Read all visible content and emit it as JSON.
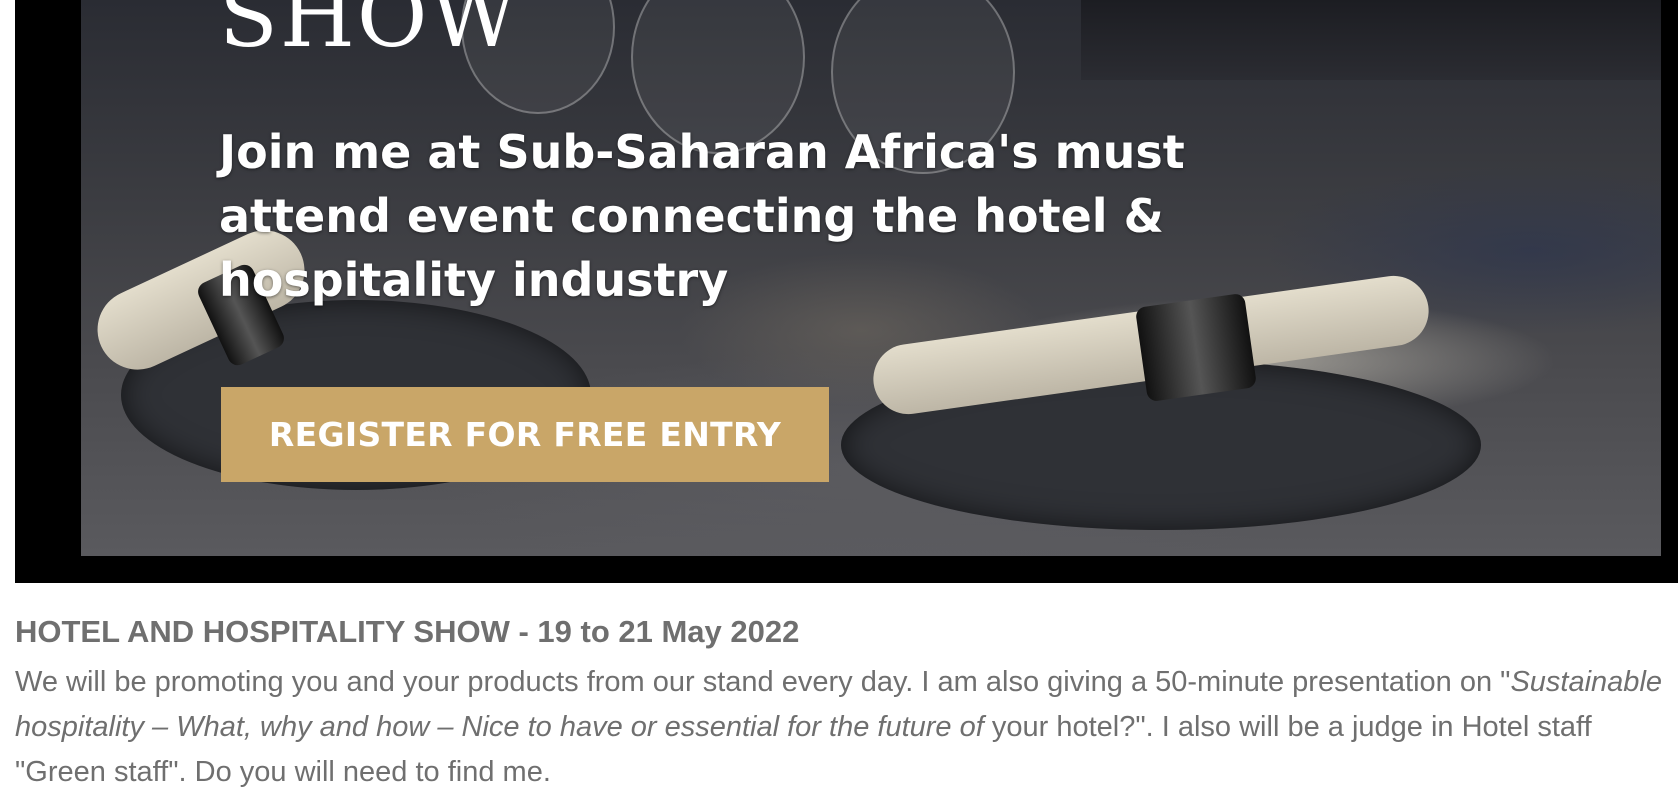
{
  "banner": {
    "logo_text": "SHOW",
    "headline": "Join me at Sub-Saharan Africa's must attend event connecting the hotel & hospitality industry",
    "cta_label": "REGISTER FOR FREE ENTRY"
  },
  "event": {
    "title": "HOTEL AND HOSPITALITY SHOW - 19 to 21 May 2022",
    "body_intro": "We will be promoting you and your products from our stand every day. I am also giving a 50-minute presentation on \"",
    "body_italic": "Sustainable hospitality – What, why and how – Nice to have or essential for the future of",
    "body_cont": " your hotel?\". I also will be a judge in Hotel staff \"Green staff\". Do you will need to find me."
  },
  "colors": {
    "cta_background": "#c9a668",
    "body_text": "#6f6f6f",
    "frame": "#000000"
  }
}
